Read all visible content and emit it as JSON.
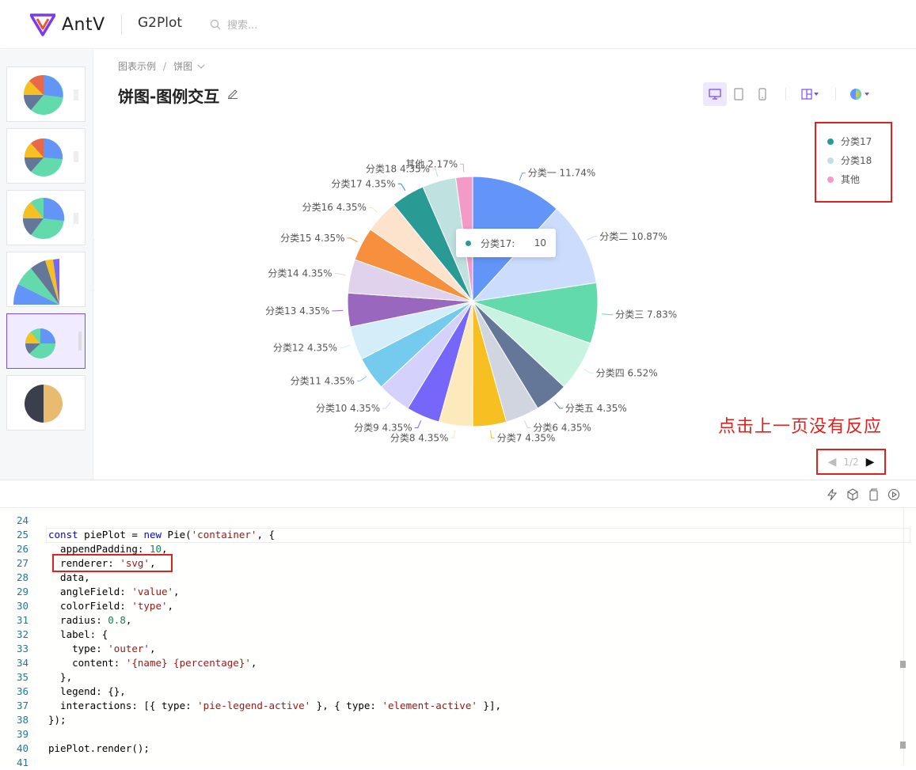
{
  "header": {
    "brand": "AntV",
    "product": "G2Plot",
    "search_placeholder": "搜索..."
  },
  "breadcrumb": {
    "root": "图表示例",
    "separator": "/",
    "current": "饼图"
  },
  "page_title": "饼图-图例交互",
  "colors": {
    "accent": "#7a4ff0",
    "annotation": "#e0211f"
  },
  "chart_data": {
    "type": "pie",
    "categories": [
      "分类一",
      "分类二",
      "分类三",
      "分类四",
      "分类五",
      "分类6",
      "分类7",
      "分类8",
      "分类9",
      "分类10",
      "分类11",
      "分类12",
      "分类13",
      "分类14",
      "分类15",
      "分类16",
      "分类17",
      "分类18",
      "其他"
    ],
    "percentages": [
      11.74,
      10.87,
      7.83,
      6.52,
      4.35,
      4.35,
      4.35,
      4.35,
      4.35,
      4.35,
      4.35,
      4.35,
      4.35,
      4.35,
      4.35,
      4.35,
      4.35,
      4.35,
      2.17
    ],
    "labels": [
      "分类一 11.74%",
      "分类二 10.87%",
      "分类三 7.83%",
      "分类四 6.52%",
      "分类五 4.35%",
      "分类6 4.35%",
      "分类7 4.35%",
      "分类8 4.35%",
      "分类9 4.35%",
      "分类10 4.35%",
      "分类11 4.35%",
      "分类12 4.35%",
      "分类13 4.35%",
      "分类14 4.35%",
      "分类15 4.35%",
      "分类16 4.35%",
      "分类17 4.35%",
      "分类18 4.35%",
      "其他 2.17%"
    ],
    "colors": [
      "#6395f9",
      "#cbdcfd",
      "#62daab",
      "#c8f3e1",
      "#657798",
      "#d0d5df",
      "#f6c022",
      "#fceabc",
      "#7666f9",
      "#d4d1fd",
      "#74cbed",
      "#d4eef9",
      "#9967bd",
      "#e0d2ec",
      "#f6903d",
      "#fde2cc",
      "#2a9b94",
      "#bfe1df",
      "#f29ac8"
    ],
    "legend": {
      "page": "1/2",
      "items": [
        {
          "label": "分类17",
          "color": "#2a9b94"
        },
        {
          "label": "分类18",
          "color": "#bfe1df"
        },
        {
          "label": "其他",
          "color": "#f29ac8"
        }
      ]
    },
    "tooltip": {
      "label": "分类17:",
      "value": "10",
      "color": "#2a9b94"
    }
  },
  "annotation_text": "点击上一页没有反应",
  "code_lines": [
    {
      "n": "24",
      "html": ""
    },
    {
      "n": "25",
      "html": "<span class=\"kw\">const</span> piePlot = <span class=\"kw\">new</span> Pie(<span class=\"str\">'container'</span>, {"
    },
    {
      "n": "26",
      "html": "  appendPadding: <span class=\"num\">10</span>,"
    },
    {
      "n": "27",
      "html": "  renderer: <span class=\"str\">'svg'</span>,"
    },
    {
      "n": "28",
      "html": "  data,"
    },
    {
      "n": "29",
      "html": "  angleField: <span class=\"str\">'value'</span>,"
    },
    {
      "n": "30",
      "html": "  colorField: <span class=\"str\">'type'</span>,"
    },
    {
      "n": "31",
      "html": "  radius: <span class=\"num\">0.8</span>,"
    },
    {
      "n": "32",
      "html": "  label: {"
    },
    {
      "n": "33",
      "html": "    type: <span class=\"str\">'outer'</span>,"
    },
    {
      "n": "34",
      "html": "    content: <span class=\"str\">'{name} {percentage}'</span>,"
    },
    {
      "n": "35",
      "html": "  },"
    },
    {
      "n": "36",
      "html": "  legend: {},"
    },
    {
      "n": "37",
      "html": "  interactions: [{ type: <span class=\"str\">'pie-legend-active'</span> }, { type: <span class=\"str\">'element-active'</span> }],"
    },
    {
      "n": "38",
      "html": "});"
    },
    {
      "n": "39",
      "html": ""
    },
    {
      "n": "40",
      "html": "piePlot.render();"
    },
    {
      "n": "41",
      "html": ""
    }
  ]
}
